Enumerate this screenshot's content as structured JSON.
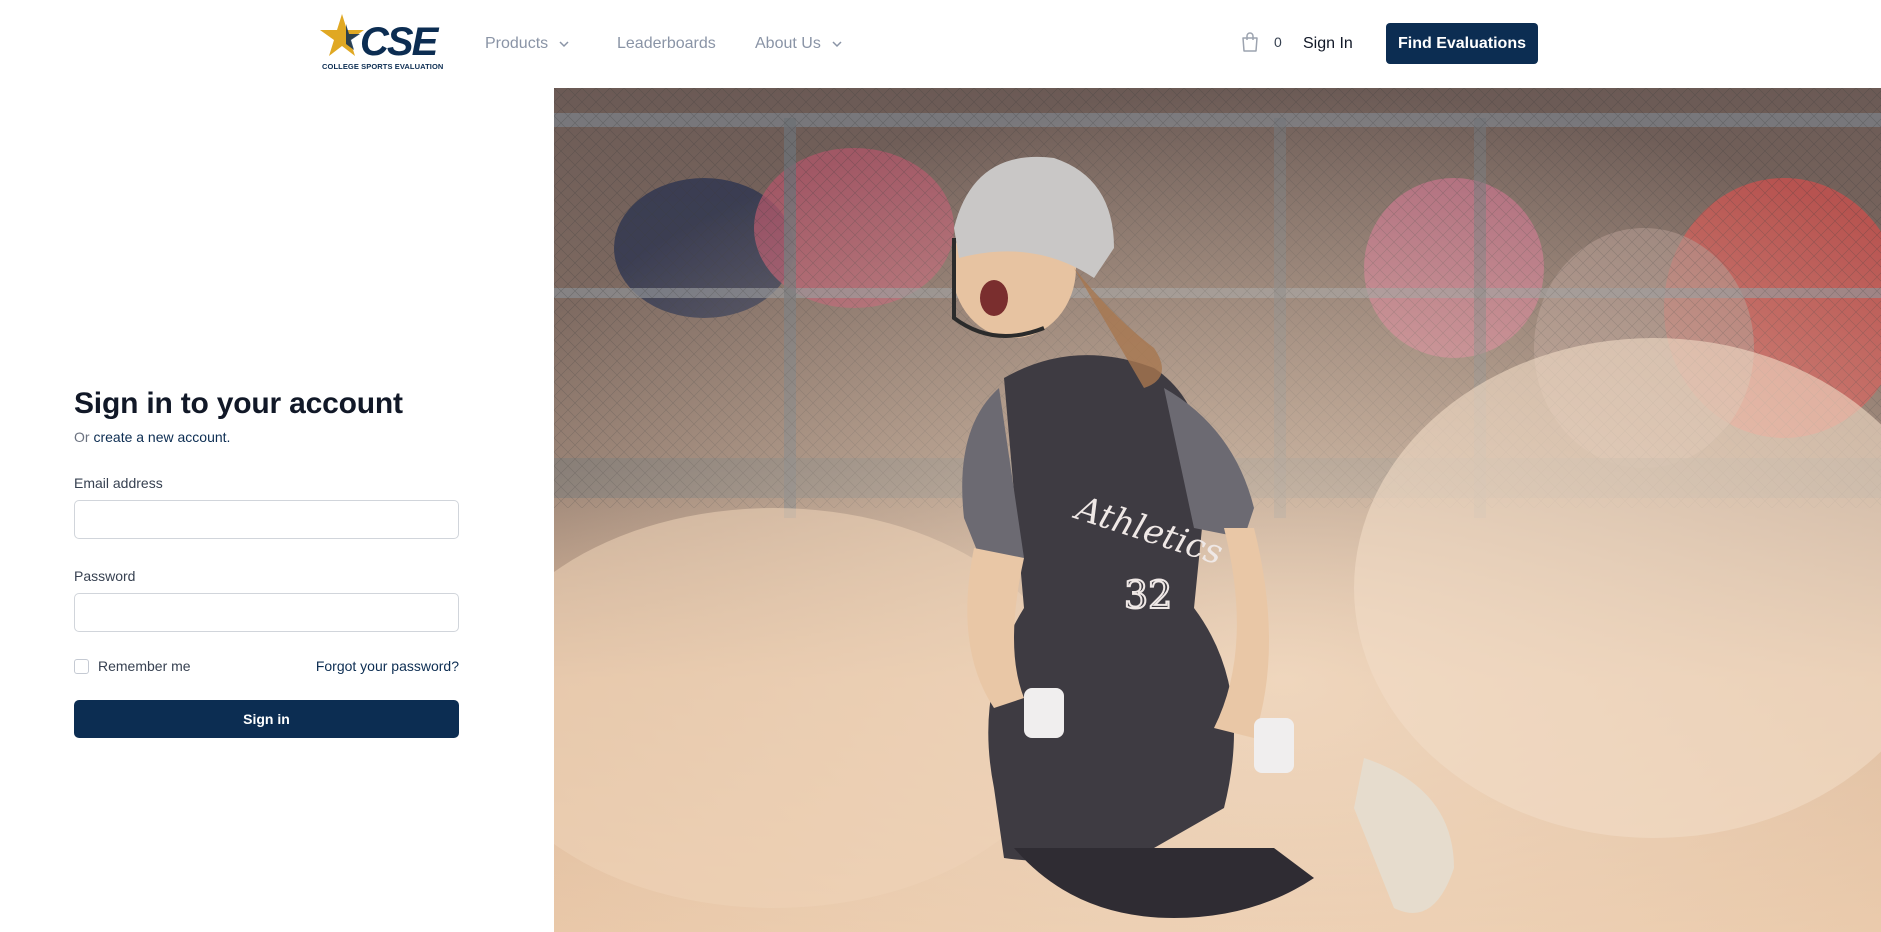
{
  "brand": {
    "name": "CSE",
    "tagline": "COLLEGE SPORTS EVALUATION",
    "primary_color": "#0c2d52",
    "star_color": "#e0a823"
  },
  "nav": {
    "products": "Products",
    "leaderboards": "Leaderboards",
    "about": "About Us"
  },
  "cart": {
    "icon": "shopping-bag-icon",
    "count": "0"
  },
  "header_actions": {
    "sign_in": "Sign In",
    "find_evaluations": "Find Evaluations"
  },
  "form": {
    "title": "Sign in to your account",
    "subtitle_prefix": "Or ",
    "create_account_link": "create a new account.",
    "email_label": "Email address",
    "email_value": "",
    "password_label": "Password",
    "password_value": "",
    "remember_label": "Remember me",
    "remember_checked": false,
    "forgot_link": "Forgot your password?",
    "submit_label": "Sign in"
  },
  "hero": {
    "jersey_text": "Athletics",
    "jersey_number": "32"
  }
}
